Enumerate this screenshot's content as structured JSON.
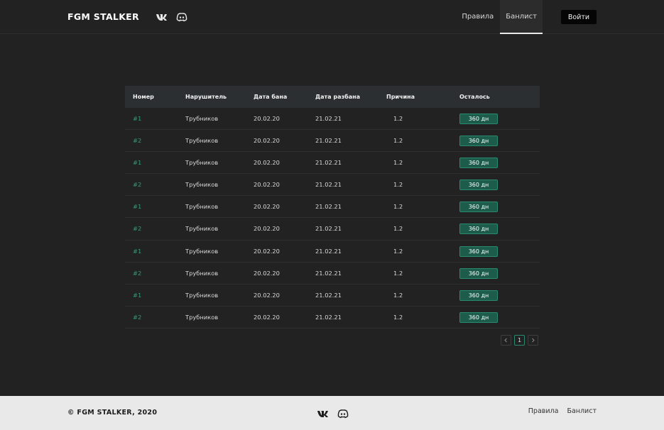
{
  "header": {
    "logo": "FGM STALKER",
    "social": [
      {
        "icon": "vk-icon"
      },
      {
        "icon": "discord-icon"
      }
    ],
    "nav": [
      {
        "label": "Правила",
        "active": false
      },
      {
        "label": "Банлист",
        "active": true
      }
    ],
    "login_label": "Войти"
  },
  "table": {
    "columns": [
      "Номер",
      "Нарушитель",
      "Дата бана",
      "Дата разбана",
      "Причина",
      "Осталось"
    ],
    "rows": [
      {
        "num": "#1",
        "violator": "Трубников",
        "ban_date": "20.02.20",
        "unban_date": "21.02.21",
        "reason": "1.2",
        "remaining": "360 дн"
      },
      {
        "num": "#2",
        "violator": "Трубников",
        "ban_date": "20.02.20",
        "unban_date": "21.02.21",
        "reason": "1.2",
        "remaining": "360 дн"
      },
      {
        "num": "#1",
        "violator": "Трубников",
        "ban_date": "20.02.20",
        "unban_date": "21.02.21",
        "reason": "1.2",
        "remaining": "360 дн"
      },
      {
        "num": "#2",
        "violator": "Трубников",
        "ban_date": "20.02.20",
        "unban_date": "21.02.21",
        "reason": "1.2",
        "remaining": "360 дн"
      },
      {
        "num": "#1",
        "violator": "Трубников",
        "ban_date": "20.02.20",
        "unban_date": "21.02.21",
        "reason": "1.2",
        "remaining": "360 дн"
      },
      {
        "num": "#2",
        "violator": "Трубников",
        "ban_date": "20.02.20",
        "unban_date": "21.02.21",
        "reason": "1.2",
        "remaining": "360 дн"
      },
      {
        "num": "#1",
        "violator": "Трубников",
        "ban_date": "20.02.20",
        "unban_date": "21.02.21",
        "reason": "1.2",
        "remaining": "360 дн"
      },
      {
        "num": "#2",
        "violator": "Трубников",
        "ban_date": "20.02.20",
        "unban_date": "21.02.21",
        "reason": "1.2",
        "remaining": "360 дн"
      },
      {
        "num": "#1",
        "violator": "Трубников",
        "ban_date": "20.02.20",
        "unban_date": "21.02.21",
        "reason": "1.2",
        "remaining": "360 дн"
      },
      {
        "num": "#2",
        "violator": "Трубников",
        "ban_date": "20.02.20",
        "unban_date": "21.02.21",
        "reason": "1.2",
        "remaining": "360 дн"
      }
    ]
  },
  "pagination": {
    "prev_icon": "chevron-left-icon",
    "current_page": "1",
    "next_icon": "chevron-right-icon"
  },
  "footer": {
    "copyright": "© FGM STALKER, 2020",
    "nav": [
      "Правила",
      "Банлист"
    ]
  },
  "colors": {
    "background": "#222222",
    "accent": "#2a8a70",
    "badge_bg": "#1d5b4b",
    "footer_bg": "#e9e9e9"
  }
}
